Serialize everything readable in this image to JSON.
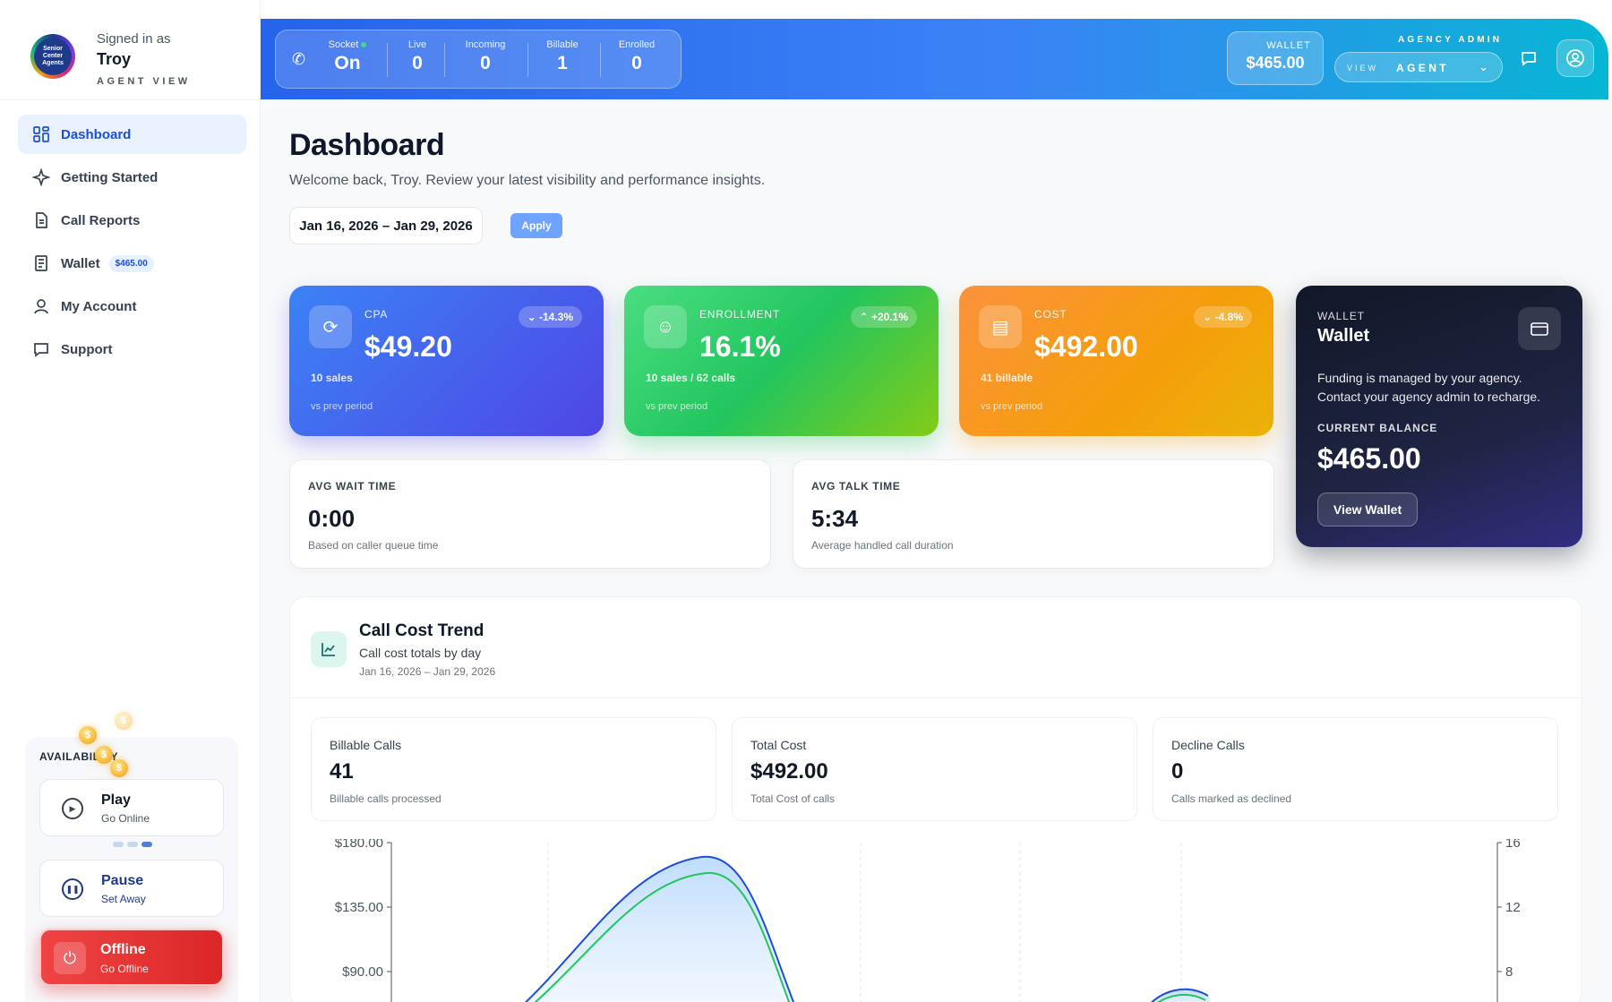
{
  "profile": {
    "logo_text": "Senior Center Agents",
    "signed_in_label": "Signed in as",
    "name": "Troy",
    "view_label": "AGENT VIEW"
  },
  "sidebar": {
    "items": [
      {
        "label": "Dashboard",
        "icon": "grid-icon",
        "active": true
      },
      {
        "label": "Getting Started",
        "icon": "sparkle-icon"
      },
      {
        "label": "Call Reports",
        "icon": "document-icon"
      },
      {
        "label": "Wallet",
        "icon": "receipt-icon",
        "badge": "$465.00"
      },
      {
        "label": "My Account",
        "icon": "user-icon"
      },
      {
        "label": "Support",
        "icon": "chat-icon"
      }
    ]
  },
  "availability": {
    "title": "AVAILABILITY",
    "play": {
      "label": "Play",
      "sub": "Go Online"
    },
    "pause": {
      "label": "Pause",
      "sub": "Set Away"
    },
    "offline": {
      "label": "Offline",
      "sub": "Go Offline"
    }
  },
  "topbar": {
    "stats": [
      {
        "label": "Socket",
        "value": "On"
      },
      {
        "label": "Live",
        "value": "0"
      },
      {
        "label": "Incoming",
        "value": "0"
      },
      {
        "label": "Billable",
        "value": "1"
      },
      {
        "label": "Enrolled",
        "value": "0"
      }
    ],
    "wallet_label": "WALLET",
    "wallet_value": "$465.00",
    "admin_label": "AGENCY ADMIN",
    "view_label": "VIEW",
    "view_value": "AGENT"
  },
  "page": {
    "title": "Dashboard",
    "subtitle": "Welcome back, Troy. Review your latest visibility and performance insights.",
    "date_range": "Jan 16, 2026 – Jan 29, 2026",
    "apply_label": "Apply"
  },
  "kpis": {
    "cpa": {
      "label": "CPA",
      "value": "$49.20",
      "delta": "-14.3%",
      "detail": "10 sales",
      "prev": "vs prev period"
    },
    "enrollment": {
      "label": "ENROLLMENT",
      "value": "16.1%",
      "delta": "+20.1%",
      "detail": "10 sales / 62 calls",
      "prev": "vs prev period"
    },
    "cost": {
      "label": "COST",
      "value": "$492.00",
      "delta": "-4.8%",
      "detail": "41 billable",
      "prev": "vs prev period"
    }
  },
  "wallet_card": {
    "label": "WALLET",
    "title": "Wallet",
    "description": "Funding is managed by your agency. Contact your agency admin to recharge.",
    "balance_label": "CURRENT BALANCE",
    "balance": "$465.00",
    "button": "View Wallet"
  },
  "metrics": {
    "wait": {
      "label": "AVG WAIT TIME",
      "value": "0:00",
      "sub": "Based on caller queue time"
    },
    "talk": {
      "label": "AVG TALK TIME",
      "value": "5:34",
      "sub": "Average handled call duration"
    }
  },
  "trend": {
    "title": "Call Cost Trend",
    "subtitle": "Call cost totals by day",
    "date_range": "Jan 16, 2026 – Jan 29, 2026",
    "summary": [
      {
        "label": "Billable Calls",
        "value": "41",
        "sub": "Billable calls processed"
      },
      {
        "label": "Total Cost",
        "value": "$492.00",
        "sub": "Total Cost of calls"
      },
      {
        "label": "Decline Calls",
        "value": "0",
        "sub": "Calls marked as declined"
      }
    ]
  },
  "chart_data": {
    "type": "area",
    "left_ticks": [
      "$180.00",
      "$135.00",
      "$90.00"
    ],
    "right_ticks": [
      "16",
      "12",
      "8"
    ],
    "grid": true
  },
  "colors": {
    "accent": "#2563eb",
    "danger": "#ef4444",
    "success": "#22c55e",
    "warning": "#f59e0b"
  }
}
